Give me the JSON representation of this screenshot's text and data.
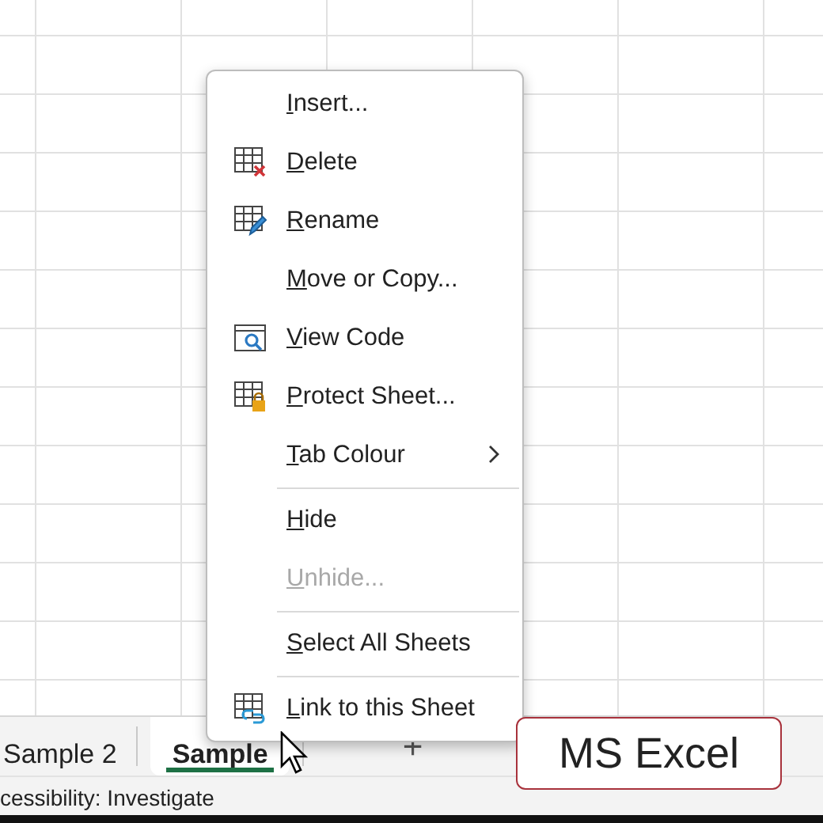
{
  "context_menu": {
    "items": [
      {
        "kind": "plain",
        "label": "Insert...",
        "access_key_underlined": true,
        "disabled": false,
        "submenu": false
      },
      {
        "kind": "delete",
        "label": "Delete",
        "access_key_underlined": true,
        "disabled": false,
        "submenu": false
      },
      {
        "kind": "rename",
        "label": "Rename",
        "access_key_underlined": true,
        "disabled": false,
        "submenu": false
      },
      {
        "kind": "plain",
        "label": "Move or Copy...",
        "access_key_underlined": true,
        "disabled": false,
        "submenu": false
      },
      {
        "kind": "code",
        "label": "View Code",
        "access_key_underlined": true,
        "disabled": false,
        "submenu": false
      },
      {
        "kind": "protect",
        "label": "Protect Sheet...",
        "access_key_underlined": true,
        "disabled": false,
        "submenu": false
      },
      {
        "kind": "plain",
        "label": "Tab Colour",
        "access_key_underlined": true,
        "disabled": false,
        "submenu": true
      },
      {
        "kind": "separator"
      },
      {
        "kind": "plain",
        "label": "Hide",
        "access_key_underlined": true,
        "disabled": false,
        "submenu": false
      },
      {
        "kind": "plain",
        "label": "Unhide...",
        "access_key_underlined": true,
        "disabled": true,
        "submenu": false
      },
      {
        "kind": "separator"
      },
      {
        "kind": "plain",
        "label": "Select All Sheets",
        "access_key_underlined": true,
        "disabled": false,
        "submenu": false
      },
      {
        "kind": "separator"
      },
      {
        "kind": "link",
        "label": "Link to this Sheet",
        "access_key_underlined": true,
        "disabled": false,
        "submenu": false
      }
    ]
  },
  "sheet_tabs": [
    {
      "label": "Sample 2",
      "selected": false
    },
    {
      "label": "Sample",
      "selected": true
    }
  ],
  "add_sheet_button": "+",
  "status_bar": {
    "text": "cessibility: Investigate"
  },
  "caption": "MS Excel"
}
